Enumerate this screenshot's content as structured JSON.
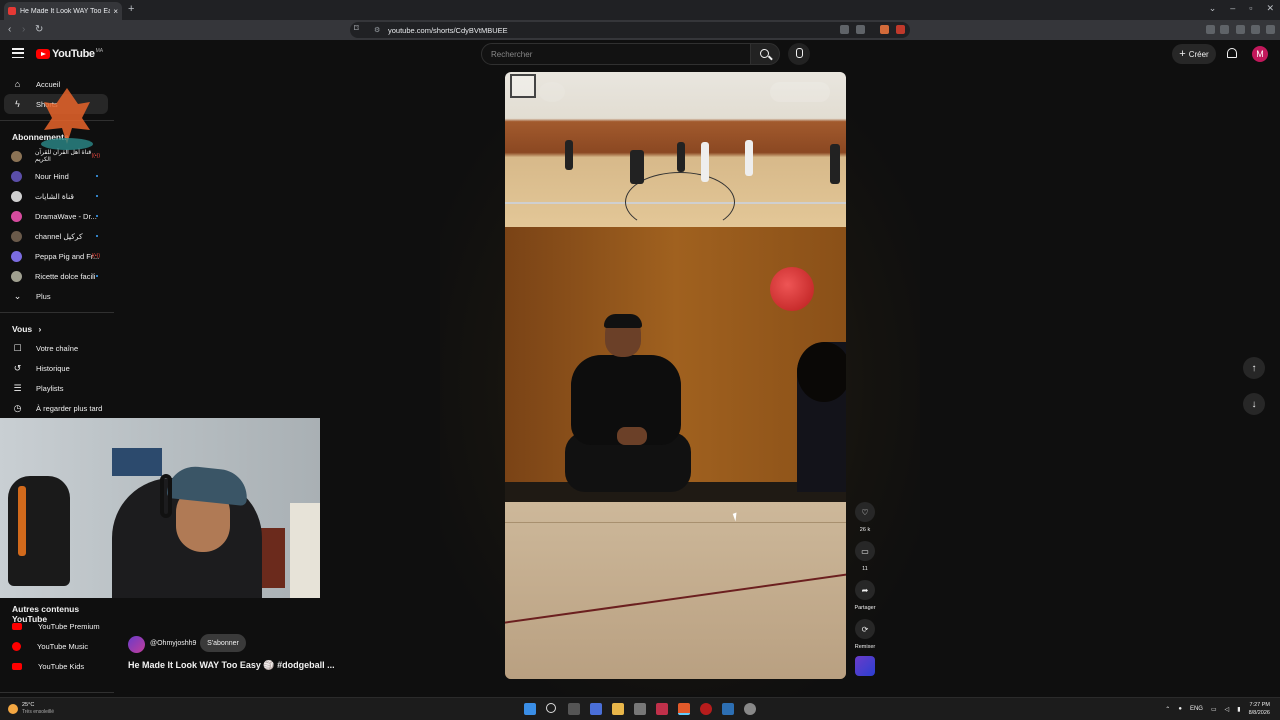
{
  "browser": {
    "tab_title": "He Made It Look WAY Too Ea",
    "tab_close": "×",
    "new_tab": "+",
    "url": "youtube.com/shorts/CdyBVtMBUEE",
    "back": "‹",
    "forward": "›",
    "reload": "↻",
    "window_min": "–",
    "window_max": "▫",
    "window_close": "✕",
    "window_chevron": "⌄"
  },
  "yt_header": {
    "logo_text": "YouTube",
    "logo_country": "MA",
    "search_placeholder": "Rechercher",
    "create_label": "Créer",
    "create_plus": "+",
    "avatar_letter": "M"
  },
  "sidebar": {
    "main": [
      {
        "label": "Accueil",
        "icon": "home-icon"
      },
      {
        "label": "Shorts",
        "icon": "shorts-icon",
        "active": true
      }
    ],
    "subscriptions_heading": "Abonnements",
    "subscriptions": [
      {
        "label": "قناة أهل القرآن للقرآن الكريم",
        "color": "#8b7355",
        "live": true
      },
      {
        "label": "Nour Hind",
        "color": "#5b4ea8",
        "new": true
      },
      {
        "label": "قناة الشايات",
        "color": "#d0d0d0",
        "new": true
      },
      {
        "label": "DramaWave - Dr...",
        "color": "#d64b9e",
        "new": true
      },
      {
        "label": "channel كركيل",
        "color": "#6a5a4a",
        "new": true
      },
      {
        "label": "Peppa Pig and Fr...",
        "color": "#7b6ce0",
        "live": true
      },
      {
        "label": "Ricette dolce facili",
        "color": "#a0a090",
        "new": true
      }
    ],
    "more_label": "Plus",
    "you_heading": "Vous",
    "you_chevron": "›",
    "you_items": [
      {
        "label": "Votre chaîne",
        "icon": "channel-icon"
      },
      {
        "label": "Historique",
        "icon": "history-icon"
      },
      {
        "label": "Playlists",
        "icon": "playlists-icon"
      },
      {
        "label": "À regarder plus tard",
        "icon": "watch-later-icon"
      }
    ],
    "more_youtube_heading": "Autres contenus YouTube",
    "more_youtube": [
      {
        "label": "YouTube Premium"
      },
      {
        "label": "YouTube Music"
      },
      {
        "label": "YouTube Kids"
      }
    ],
    "live_badge": "((•))"
  },
  "short": {
    "channel_handle": "@Ohmyjoshh9",
    "subscribe_label": "S'abonner",
    "title": "He Made It Look WAY Too Easy 🏐 #dodgeball ...",
    "likes": "26 k",
    "comments": "11",
    "share_label": "Partager",
    "remix_label": "Remixer"
  },
  "taskbar": {
    "temp": "25°C",
    "weather": "Très ensoleillé",
    "lang": "ENG",
    "time": "7:27 PM",
    "date": "8/8/2026"
  },
  "icons": {
    "like": "♡",
    "comment": "▭",
    "share": "➦",
    "remix": "⟳",
    "up": "↑",
    "down": "↓",
    "chevron": "⌄"
  },
  "colors": {
    "yt_red": "#ff0000",
    "bg": "#0f0f0f",
    "avatar": "#c2185b"
  }
}
